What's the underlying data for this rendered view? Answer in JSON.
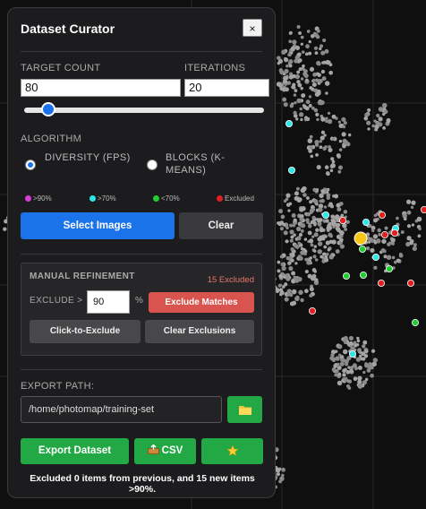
{
  "panel": {
    "title": "Dataset Curator",
    "close_label": "×"
  },
  "target": {
    "label": "TARGET COUNT",
    "value": "80"
  },
  "iterations": {
    "label": "ITERATIONS",
    "value": "20"
  },
  "slider": {
    "value_fraction": 0.1
  },
  "algorithm": {
    "label": "ALGORITHM",
    "options": [
      {
        "label": "DIVERSITY (FPS)",
        "selected": true
      },
      {
        "label": "BLOCKS (K-MEANS)",
        "selected": false
      }
    ]
  },
  "legend": [
    {
      "label": ">90%",
      "color": "#d63fd6"
    },
    {
      "label": ">70%",
      "color": "#2ee6e6"
    },
    {
      "label": "<70%",
      "color": "#22cc33"
    },
    {
      "label": "Excluded",
      "color": "#e02020"
    }
  ],
  "actions": {
    "select_label": "Select Images",
    "clear_label": "Clear"
  },
  "refine": {
    "heading": "MANUAL REFINEMENT",
    "excluded_count": "15 Excluded",
    "exclude_label": "EXCLUDE >",
    "exclude_value": "90",
    "percent": "%",
    "exclude_matches_label": "Exclude Matches",
    "click_to_exclude_label": "Click-to-Exclude",
    "clear_exclusions_label": "Clear Exclusions"
  },
  "export": {
    "label": "EXPORT PATH:",
    "path": "/home/photomap/training-set",
    "browse_icon": "folder-icon",
    "export_label": "Export Dataset",
    "csv_label": "CSV",
    "csv_icon": "outbox-icon",
    "star_icon": "star-icon"
  },
  "status": "Excluded 0 items from previous, and 15 new items >90%.",
  "colors": {
    "accent": "#1a73e8",
    "danger": "#d9534f",
    "success": "#22a845",
    "excluded_text": "#e8746c"
  }
}
